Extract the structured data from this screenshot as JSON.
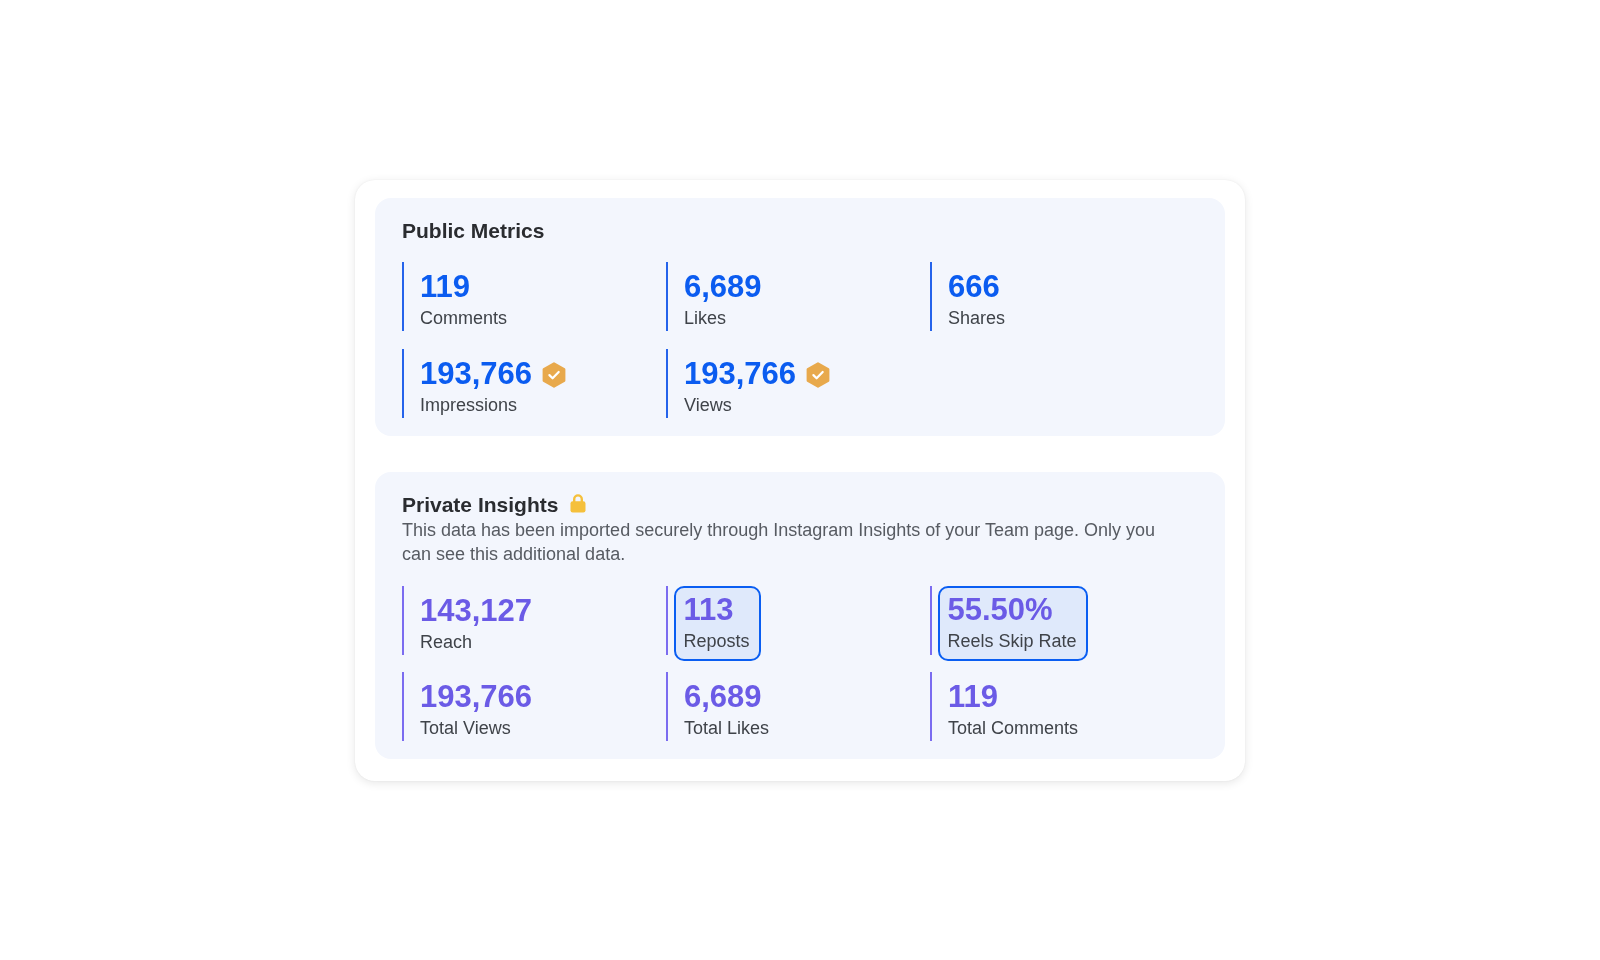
{
  "sections": [
    {
      "kind": "public",
      "title": "Public Metrics",
      "metrics": [
        {
          "value": "119",
          "label": "Comments",
          "verified": false
        },
        {
          "value": "6,689",
          "label": "Likes",
          "verified": false
        },
        {
          "value": "666",
          "label": "Shares",
          "verified": false
        },
        {
          "value": "193,766",
          "label": "Impressions",
          "verified": true
        },
        {
          "value": "193,766",
          "label": "Views",
          "verified": true
        }
      ]
    },
    {
      "kind": "private",
      "title": "Private Insights",
      "locked": true,
      "description": "This data has been imported securely through Instagram Insights of your Team page. Only you can see this additional data.",
      "metrics": [
        {
          "value": "143,127",
          "label": "Reach",
          "highlighted": false
        },
        {
          "value": "113",
          "label": "Reposts",
          "highlighted": true
        },
        {
          "value": "55.50%",
          "label": "Reels Skip Rate",
          "highlighted": true
        },
        {
          "value": "193,766",
          "label": "Total Views",
          "highlighted": false
        },
        {
          "value": "6,689",
          "label": "Total Likes",
          "highlighted": false
        },
        {
          "value": "119",
          "label": "Total Comments",
          "highlighted": false
        }
      ]
    }
  ]
}
